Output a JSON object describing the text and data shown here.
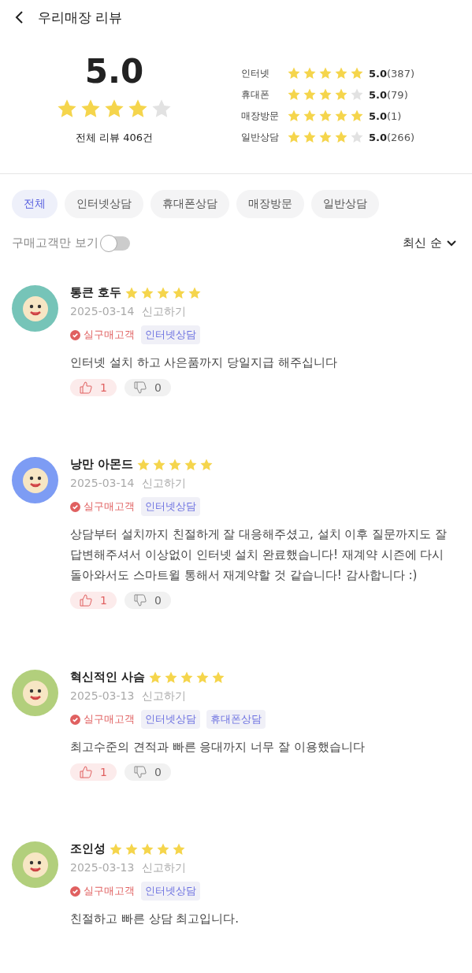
{
  "header": {
    "title": "우리매장 리뷰"
  },
  "summary": {
    "score": "5.0",
    "stars": 4,
    "total": "전체 리뷰 406건",
    "categories": [
      {
        "label": "인터넷",
        "stars": 5,
        "score": "5.0",
        "count": "(387)"
      },
      {
        "label": "휴대폰",
        "stars": 4,
        "score": "5.0",
        "count": "(79)"
      },
      {
        "label": "매장방문",
        "stars": 5,
        "score": "5.0",
        "count": "(1)"
      },
      {
        "label": "일반상담",
        "stars": 4,
        "score": "5.0",
        "count": "(266)"
      }
    ]
  },
  "filters": [
    {
      "label": "전체",
      "selected": true
    },
    {
      "label": "인터넷상담",
      "selected": false
    },
    {
      "label": "휴대폰상담",
      "selected": false
    },
    {
      "label": "매장방문",
      "selected": false
    },
    {
      "label": "일반상담",
      "selected": false
    }
  ],
  "buyer_only": {
    "label": "구매고객만 보기",
    "on": false
  },
  "sort": {
    "label": "최신 순"
  },
  "reviews": [
    {
      "name": "통큰 호두",
      "color": "#76c4b8",
      "stars": 5,
      "date": "2025-03-14",
      "report": "신고하기",
      "badge": "실구매고객",
      "tags": [
        "인터넷상담"
      ],
      "text": "인터넷 설치 하고 사은품까지 당일지급 해주십니다",
      "likes": "1",
      "dislikes": "0"
    },
    {
      "name": "낭만 아몬드",
      "color": "#7d9cf4",
      "stars": 5,
      "date": "2025-03-14",
      "report": "신고하기",
      "badge": "실구매고객",
      "tags": [
        "인터넷상담"
      ],
      "text": "상담부터 설치까지 친절하게 잘 대응해주셨고, 설치 이후 질문까지도 잘 답변해주셔서 이상없이 인터넷 설치 완료했습니다! 재계약 시즌에 다시 돌아와서도 스마트윌 통해서 재계약할 것 같습니다! 감사합니다 :)",
      "likes": "1",
      "dislikes": "0"
    },
    {
      "name": "혁신적인 사슴",
      "color": "#b2cf7c",
      "stars": 5,
      "date": "2025-03-13",
      "report": "신고하기",
      "badge": "실구매고객",
      "tags": [
        "인터넷상담",
        "휴대폰상담"
      ],
      "text": "최고수준의 견적과 빠른 응대까지 너무 잘 이용했습니다",
      "likes": "1",
      "dislikes": "0"
    },
    {
      "name": "조인성",
      "color": "#b2cf7c",
      "stars": 5,
      "date": "2025-03-13",
      "report": "신고하기",
      "badge": "실구매고객",
      "tags": [
        "인터넷상담"
      ],
      "text": "친절하고 빠른 상담 최고입니다."
    }
  ]
}
